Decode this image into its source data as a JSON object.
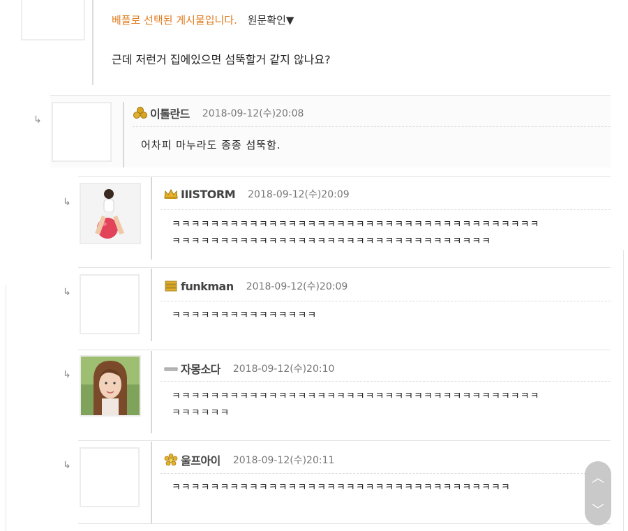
{
  "top_comment": {
    "best_notice": "베플로 선택된 게시물입니다.",
    "original_link": "원문확인▼",
    "body": "근데 저런거 집에있으면 섬뚝할거 같지 않나요?"
  },
  "replies": [
    {
      "nickname": "이톨란드",
      "date": "2018-09-12(수)20:08",
      "body": "어차피 마누라도 종종 섬뚝함.",
      "rank_icon": "gold-coins-icon",
      "avatar": "empty"
    },
    {
      "nickname": "IIISTORM",
      "date": "2018-09-12(수)20:09",
      "body": "ㅋㅋㅋㅋㅋㅋㅋㅋㅋㅋㅋㅋㅋㅋㅋㅋㅋㅋㅋㅋㅋㅋㅋㅋㅋㅋㅋㅋㅋㅋㅋㅋㅋㅋㅋㅋㅋㅋ\nㅋㅋㅋㅋㅋㅋㅋㅋㅋㅋㅋㅋㅋㅋㅋㅋㅋㅋㅋㅋㅋㅋㅋㅋㅋㅋㅋㅋㅋㅋㅋㅋㅋ",
      "rank_icon": "gold-crown-icon",
      "avatar": "photo-woman-on-ball"
    },
    {
      "nickname": "funkman",
      "date": "2018-09-12(수)20:09",
      "body": "ㅋㅋㅋㅋㅋㅋㅋㅋㅋㅋㅋㅋㅋㅋㅋ",
      "rank_icon": "gold-bars-icon",
      "avatar": "empty"
    },
    {
      "nickname": "자몽소다",
      "date": "2018-09-12(수)20:10",
      "body": "ㅋㅋㅋㅋㅋㅋㅋㅋㅋㅋㅋㅋㅋㅋㅋㅋㅋㅋㅋㅋㅋㅋㅋㅋㅋㅋㅋㅋㅋㅋㅋㅋㅋㅋㅋㅋㅋㅋ\nㅋㅋㅋㅋㅋㅋ",
      "rank_icon": "gray-bar-icon",
      "avatar": "photo-woman-portrait"
    },
    {
      "nickname": "울프아이",
      "date": "2018-09-12(수)20:11",
      "body": "ㅋㅋㅋㅋㅋㅋㅋㅋㅋㅋㅋㅋㅋㅋㅋㅋㅋㅋㅋㅋㅋㅋㅋㅋㅋㅋㅋㅋㅋㅋㅋㅋㅋㅋㅋ",
      "rank_icon": "gold-flower-icon",
      "avatar": "empty"
    }
  ],
  "reply_arrow": "↳",
  "scroll": {
    "up": "︿",
    "down": "﹀"
  },
  "colors": {
    "best_notice": "#e07c1f",
    "pill": "#c9c9c9"
  }
}
